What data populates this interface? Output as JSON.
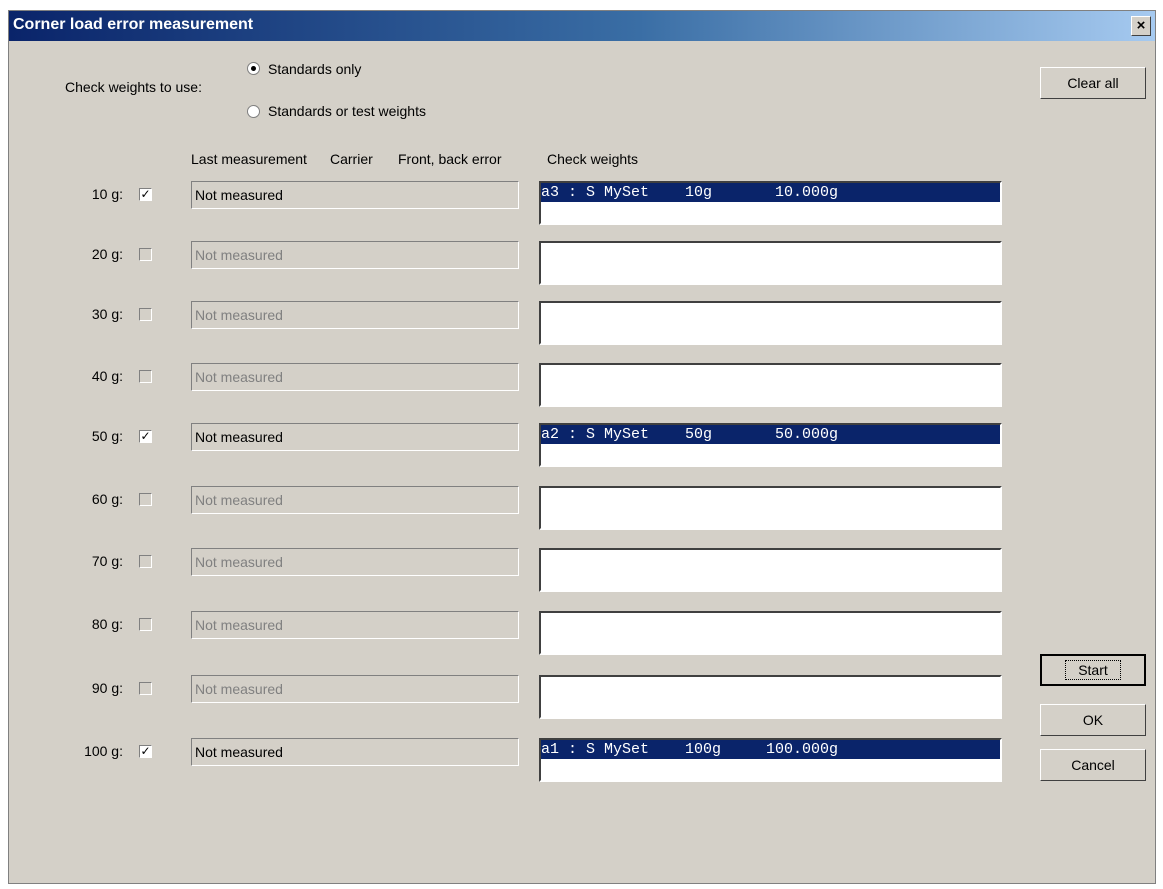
{
  "window": {
    "title": "Corner load error measurement",
    "close_glyph": "×"
  },
  "options": {
    "check_weights_label": "Check weights to use:",
    "radio_standards_only": "Standards only",
    "radio_standards_or_test": "Standards or test weights",
    "selected": "Standards only"
  },
  "headers": {
    "last_measurement": "Last measurement",
    "carrier": "Carrier",
    "front_back_error": "Front, back error",
    "check_weights": "Check weights"
  },
  "rows": [
    {
      "label": "10 g:",
      "checked": true,
      "measurement": "Not measured",
      "list_item": "a3 : S MySet    10g       10.000g"
    },
    {
      "label": "20 g:",
      "checked": false,
      "measurement": "Not measured",
      "list_item": ""
    },
    {
      "label": "30 g:",
      "checked": false,
      "measurement": "Not measured",
      "list_item": ""
    },
    {
      "label": "40 g:",
      "checked": false,
      "measurement": "Not measured",
      "list_item": ""
    },
    {
      "label": "50 g:",
      "checked": true,
      "measurement": "Not measured",
      "list_item": "a2 : S MySet    50g       50.000g"
    },
    {
      "label": "60 g:",
      "checked": false,
      "measurement": "Not measured",
      "list_item": ""
    },
    {
      "label": "70 g:",
      "checked": false,
      "measurement": "Not measured",
      "list_item": ""
    },
    {
      "label": "80 g:",
      "checked": false,
      "measurement": "Not measured",
      "list_item": ""
    },
    {
      "label": "90 g:",
      "checked": false,
      "measurement": "Not measured",
      "list_item": ""
    },
    {
      "label": "100 g:",
      "checked": true,
      "measurement": "Not measured",
      "list_item": "a1 : S MySet    100g     100.000g"
    }
  ],
  "buttons": {
    "clear_all": "Clear all",
    "start": "Start",
    "ok": "OK",
    "cancel": "Cancel"
  },
  "colors": {
    "selection_bg": "#0a246a",
    "dialog_bg": "#d4d0c8"
  }
}
